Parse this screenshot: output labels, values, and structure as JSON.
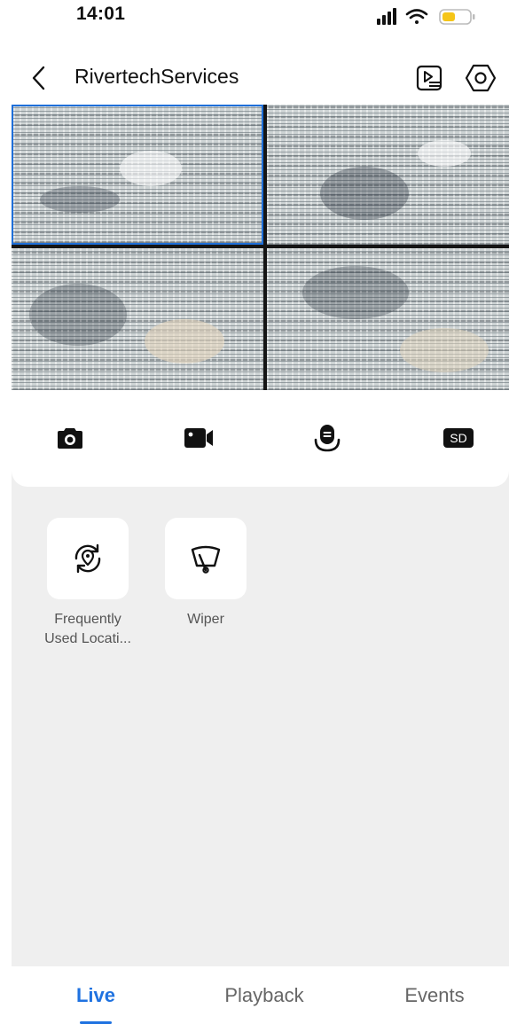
{
  "status_bar": {
    "time": "14:01",
    "icons": [
      "signal-icon",
      "wifi-icon",
      "battery-icon"
    ],
    "battery_color": "#f5c518"
  },
  "header": {
    "title": "RivertechServices",
    "icons": [
      "back-icon",
      "playback-list-icon",
      "settings-icon"
    ]
  },
  "video_grid": {
    "channel_count": 4,
    "selected_channel": 1,
    "selected_color": "#1e6fd9"
  },
  "toolbar": {
    "items": [
      {
        "name": "snapshot",
        "icon": "camera-icon"
      },
      {
        "name": "record",
        "icon": "video-camera-icon"
      },
      {
        "name": "talk",
        "icon": "intercom-icon"
      },
      {
        "name": "quality",
        "label": "SD"
      }
    ]
  },
  "features": [
    {
      "label": "Frequently Used Locati...",
      "icon": "location-preset-icon"
    },
    {
      "label": "Wiper",
      "icon": "wiper-icon"
    }
  ],
  "tabs": [
    {
      "label": "Live",
      "active": true
    },
    {
      "label": "Playback",
      "active": false
    },
    {
      "label": "Events",
      "active": false
    }
  ],
  "colors": {
    "accent": "#1f72e0",
    "panel_background": "#efefef"
  }
}
